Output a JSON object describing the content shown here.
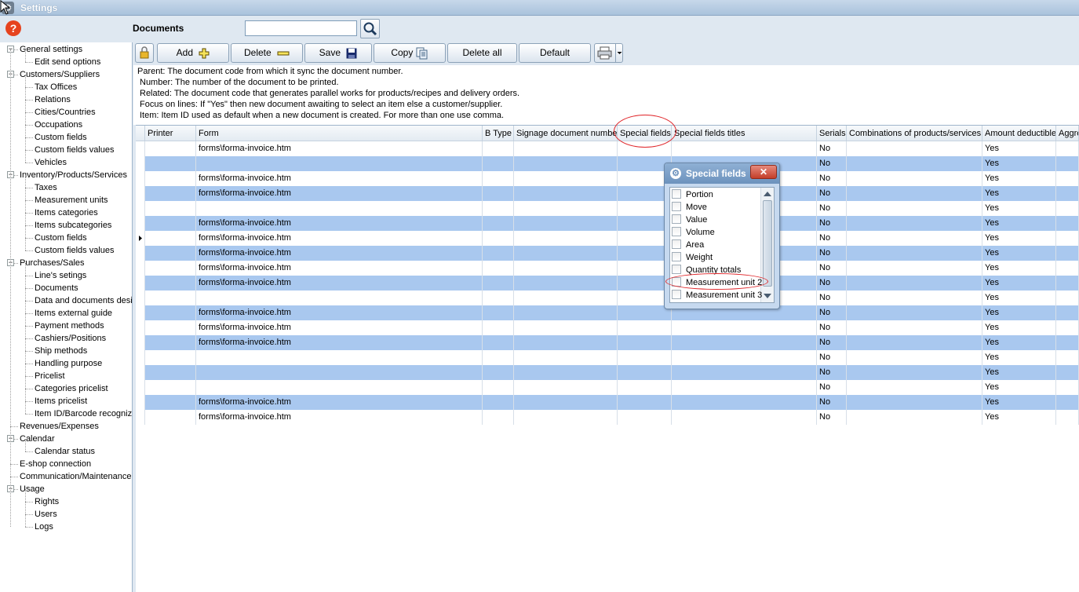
{
  "window": {
    "title": "Settings"
  },
  "header": {
    "documents_label": "Documents",
    "search_value": ""
  },
  "tree": [
    {
      "label": "General settings",
      "level": 0,
      "expander": "−"
    },
    {
      "label": "Edit send options",
      "level": 1
    },
    {
      "label": "Customers/Suppliers",
      "level": 0,
      "expander": "−"
    },
    {
      "label": "Tax Offices",
      "level": 1
    },
    {
      "label": "Relations",
      "level": 1
    },
    {
      "label": "Cities/Countries",
      "level": 1
    },
    {
      "label": "Occupations",
      "level": 1
    },
    {
      "label": "Custom fields",
      "level": 1
    },
    {
      "label": "Custom fields values",
      "level": 1
    },
    {
      "label": "Vehicles",
      "level": 1
    },
    {
      "label": "Inventory/Products/Services",
      "level": 0,
      "expander": "−"
    },
    {
      "label": "Taxes",
      "level": 1
    },
    {
      "label": "Measurement units",
      "level": 1
    },
    {
      "label": "Items categories",
      "level": 1
    },
    {
      "label": "Items subcategories",
      "level": 1
    },
    {
      "label": "Custom fields",
      "level": 1
    },
    {
      "label": "Custom fields values",
      "level": 1
    },
    {
      "label": "Purchases/Sales",
      "level": 0,
      "expander": "−"
    },
    {
      "label": "Line's setings",
      "level": 1
    },
    {
      "label": "Documents",
      "level": 1
    },
    {
      "label": "Data and documents desi",
      "level": 1
    },
    {
      "label": "Items external guide",
      "level": 1
    },
    {
      "label": "Payment methods",
      "level": 1
    },
    {
      "label": "Cashiers/Positions",
      "level": 1
    },
    {
      "label": "Ship methods",
      "level": 1
    },
    {
      "label": "Handling purpose",
      "level": 1
    },
    {
      "label": "Pricelist",
      "level": 1
    },
    {
      "label": "Categories pricelist",
      "level": 1
    },
    {
      "label": "Items pricelist",
      "level": 1
    },
    {
      "label": "Item ID/Barcode recognize",
      "level": 1
    },
    {
      "label": "Revenues/Expenses",
      "level": 0
    },
    {
      "label": "Calendar",
      "level": 0,
      "expander": "−"
    },
    {
      "label": "Calendar status",
      "level": 1
    },
    {
      "label": "E-shop connection",
      "level": 0
    },
    {
      "label": "Communication/Maintenance",
      "level": 0
    },
    {
      "label": "Usage",
      "level": 0,
      "expander": "−"
    },
    {
      "label": "Rights",
      "level": 1
    },
    {
      "label": "Users",
      "level": 1
    },
    {
      "label": "Logs",
      "level": 1
    }
  ],
  "toolbar": {
    "add": "Add",
    "delete": "Delete",
    "save": "Save",
    "copy": "Copy",
    "delete_all": "Delete all",
    "default": "Default"
  },
  "info_lines": [
    "Parent: The document code from which it sync the document number.",
    "Number: The number of the document to be printed.",
    "Related: The document code that generates parallel works for products/recipes and delivery orders.",
    "Focus on lines: If \"Yes\" then new document awaiting to select an item else a customer/supplier.",
    "Item: Item ID used as default when a new document is created. For more than one use comma."
  ],
  "grid": {
    "columns": [
      "Printer",
      "Form",
      "B Type",
      "Signage document number",
      "Special fields",
      "Special fields titles",
      "Serials",
      "Combinations of products/services",
      "Amount deductible",
      "Aggre"
    ],
    "rows": [
      {
        "form": "forms\\forma-invoice.htm",
        "serials": "No",
        "amount": "Yes"
      },
      {
        "form": "",
        "serials": "No",
        "amount": "Yes"
      },
      {
        "form": "forms\\forma-invoice.htm",
        "serials": "No",
        "amount": "Yes"
      },
      {
        "form": "forms\\forma-invoice.htm",
        "serials": "No",
        "amount": "Yes"
      },
      {
        "form": "",
        "serials": "No",
        "amount": "Yes"
      },
      {
        "form": "forms\\forma-invoice.htm",
        "serials": "No",
        "amount": "Yes"
      },
      {
        "form": "forms\\forma-invoice.htm",
        "serials": "No",
        "amount": "Yes"
      },
      {
        "form": "forms\\forma-invoice.htm",
        "serials": "No",
        "amount": "Yes"
      },
      {
        "form": "forms\\forma-invoice.htm",
        "serials": "No",
        "amount": "Yes"
      },
      {
        "form": "forms\\forma-invoice.htm",
        "serials": "No",
        "amount": "Yes"
      },
      {
        "form": "",
        "serials": "No",
        "amount": "Yes"
      },
      {
        "form": "forms\\forma-invoice.htm",
        "serials": "No",
        "amount": "Yes"
      },
      {
        "form": "forms\\forma-invoice.htm",
        "serials": "No",
        "amount": "Yes"
      },
      {
        "form": "forms\\forma-invoice.htm",
        "serials": "No",
        "amount": "Yes"
      },
      {
        "form": "",
        "serials": "No",
        "amount": "Yes"
      },
      {
        "form": "",
        "serials": "No",
        "amount": "Yes"
      },
      {
        "form": "",
        "serials": "No",
        "amount": "Yes"
      },
      {
        "form": "forms\\forma-invoice.htm",
        "serials": "No",
        "amount": "Yes"
      },
      {
        "form": "forms\\forma-invoice.htm",
        "serials": "No",
        "amount": "Yes"
      }
    ],
    "current_row": 6
  },
  "dialog": {
    "title": "Special fields",
    "close": "✕",
    "options": [
      "Portion",
      "Move",
      "Value",
      "Volume",
      "Area",
      "Weight",
      "Quantity totals",
      "Measurement unit 2",
      "Measurement unit 3"
    ]
  },
  "colors": {
    "row_alt": "#a9c8ef",
    "annotation": "#e0262a"
  }
}
